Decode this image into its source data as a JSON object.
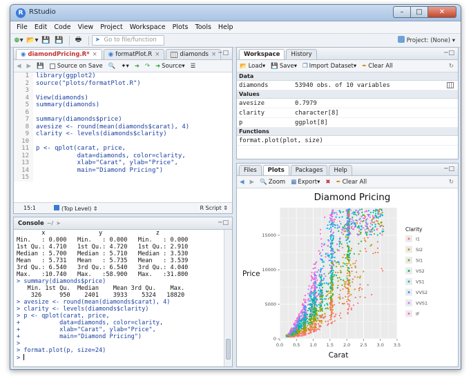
{
  "window": {
    "title": "RStudio",
    "controls": [
      "minimize",
      "maximize",
      "close"
    ]
  },
  "menu": [
    "File",
    "Edit",
    "Code",
    "View",
    "Project",
    "Workspace",
    "Plots",
    "Tools",
    "Help"
  ],
  "toolbar": {
    "goto_placeholder": "Go to file/function",
    "project": "Project: (None)"
  },
  "editor": {
    "tabs": [
      {
        "label": "diamondPricing.R*",
        "active": true
      },
      {
        "label": "formatPlot.R",
        "active": false
      },
      {
        "label": "diamonds",
        "active": false
      }
    ],
    "source_on_save": "Source on Save",
    "source_button": "Source",
    "lines": [
      {
        "n": "1",
        "t": "library(ggplot2)"
      },
      {
        "n": "2",
        "t": "source(\"plots/formatPlot.R\")"
      },
      {
        "n": "3",
        "t": ""
      },
      {
        "n": "4",
        "t": "View(diamonds)"
      },
      {
        "n": "5",
        "t": "summary(diamonds)"
      },
      {
        "n": "6",
        "t": ""
      },
      {
        "n": "7",
        "t": "summary(diamonds$price)"
      },
      {
        "n": "8",
        "t": "avesize <- round(mean(diamonds$carat), 4)"
      },
      {
        "n": "9",
        "t": "clarity <- levels(diamonds$clarity)"
      },
      {
        "n": "10",
        "t": ""
      },
      {
        "n": "11",
        "t": "p <- qplot(carat, price,"
      },
      {
        "n": "12",
        "t": "           data=diamonds, color=clarity,"
      },
      {
        "n": "13",
        "t": "           xlab=\"Carat\", ylab=\"Price\","
      },
      {
        "n": "14",
        "t": "           main=\"Diamond Pricing\")"
      },
      {
        "n": "15",
        "t": ""
      }
    ],
    "status_pos": "15:1",
    "status_level": "(Top Level)",
    "status_type": "R Script"
  },
  "console": {
    "title": "Console",
    "path": "~/",
    "lines": [
      {
        "k": "out",
        "t": "       x               y               z"
      },
      {
        "k": "out",
        "t": "Min.   : 0.000   Min.   : 0.000   Min.   : 0.000"
      },
      {
        "k": "out",
        "t": "1st Qu.: 4.710   1st Qu.: 4.720   1st Qu.: 2.910"
      },
      {
        "k": "out",
        "t": "Median : 5.700   Median : 5.710   Median : 3.530"
      },
      {
        "k": "out",
        "t": "Mean   : 5.731   Mean   : 5.735   Mean   : 3.539"
      },
      {
        "k": "out",
        "t": "3rd Qu.: 6.540   3rd Qu.: 6.540   3rd Qu.: 4.040"
      },
      {
        "k": "out",
        "t": "Max.   :10.740   Max.   :58.900   Max.   :31.800"
      },
      {
        "k": "cmd",
        "t": "> summary(diamonds$price)"
      },
      {
        "k": "out",
        "t": "   Min. 1st Qu.  Median    Mean 3rd Qu.    Max."
      },
      {
        "k": "out",
        "t": "    326     950    2401    3933    5324   18820"
      },
      {
        "k": "cmd",
        "t": "> avesize <- round(mean(diamonds$carat), 4)"
      },
      {
        "k": "cmd",
        "t": "> clarity <- levels(diamonds$clarity)"
      },
      {
        "k": "cmd",
        "t": "> p <- qplot(carat, price,"
      },
      {
        "k": "cmd",
        "t": "+           data=diamonds, color=clarity,"
      },
      {
        "k": "cmd",
        "t": "+           xlab=\"Carat\", ylab=\"Price\","
      },
      {
        "k": "cmd",
        "t": "+           main=\"Diamond Pricing\")"
      },
      {
        "k": "cmd",
        "t": ">"
      },
      {
        "k": "cmd",
        "t": "> format.plot(p, size=24)"
      },
      {
        "k": "cmd",
        "t": "> "
      }
    ]
  },
  "workspace": {
    "tabs": [
      "Workspace",
      "History"
    ],
    "toolbar": {
      "load": "Load",
      "save": "Save",
      "import": "Import Dataset",
      "clear": "Clear All"
    },
    "data_header": "Data",
    "data": [
      {
        "name": "diamonds",
        "value": "53940 obs. of 10 variables"
      }
    ],
    "values_header": "Values",
    "values": [
      {
        "name": "avesize",
        "value": "0.7979"
      },
      {
        "name": "clarity",
        "value": "character[8]"
      },
      {
        "name": "p",
        "value": "ggplot[8]"
      }
    ],
    "functions_header": "Functions",
    "functions": [
      {
        "name": "format.plot(plot, size)"
      }
    ]
  },
  "plots_pane": {
    "tabs": [
      "Files",
      "Plots",
      "Packages",
      "Help"
    ],
    "toolbar": {
      "zoom": "Zoom",
      "export": "Export",
      "clear": "Clear All"
    }
  },
  "chart_data": {
    "type": "scatter",
    "title": "Diamond Pricing",
    "xlabel": "Carat",
    "ylabel": "Price",
    "xlim": [
      0,
      3.5
    ],
    "ylim": [
      0,
      19000
    ],
    "x_ticks": [
      "0.0",
      "0.5",
      "1.0",
      "1.5",
      "2.0",
      "2.5",
      "3.0",
      "3.5"
    ],
    "y_ticks": [
      "0",
      "5000",
      "10000",
      "15000"
    ],
    "legend_title": "Clarity",
    "legend_position": "right",
    "grid": true,
    "background": "#ebebeb",
    "series": [
      {
        "name": "I1",
        "color": "#f8766d"
      },
      {
        "name": "SI2",
        "color": "#cd9600"
      },
      {
        "name": "SI1",
        "color": "#7cae00"
      },
      {
        "name": "VS2",
        "color": "#00be67"
      },
      {
        "name": "VS1",
        "color": "#00bfc4"
      },
      {
        "name": "VVS2",
        "color": "#00a9ff"
      },
      {
        "name": "VVS1",
        "color": "#c77cff"
      },
      {
        "name": "IF",
        "color": "#ff61cc"
      }
    ]
  }
}
